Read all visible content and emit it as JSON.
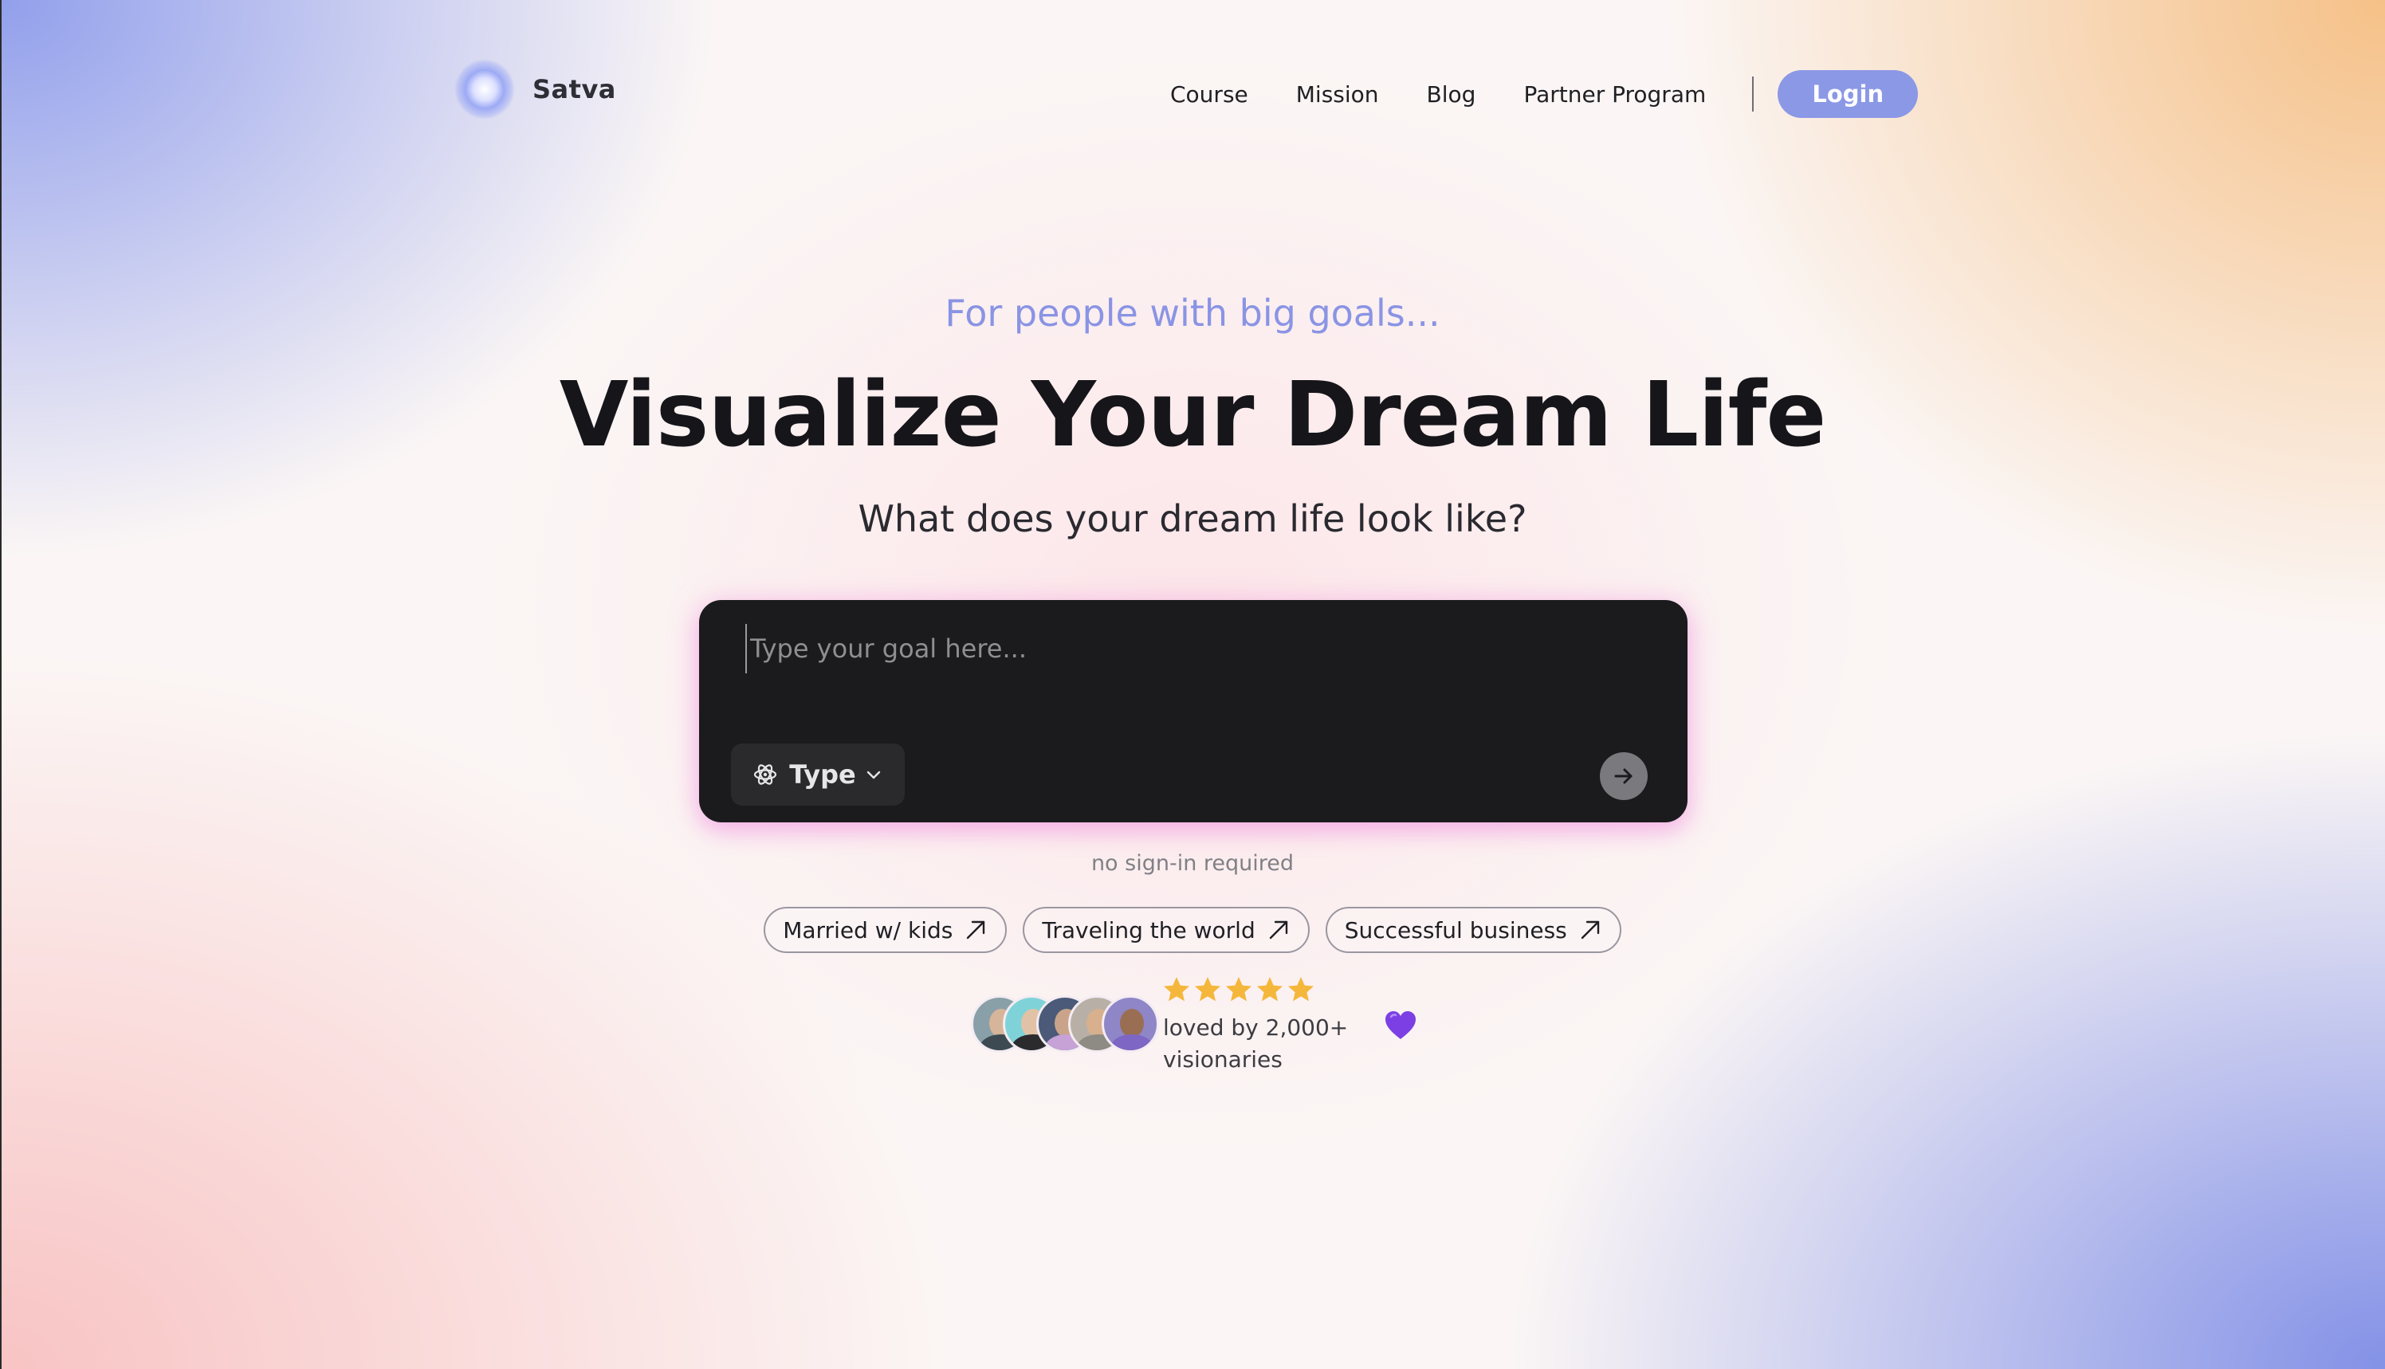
{
  "brand": {
    "name": "Satva"
  },
  "nav": {
    "links": [
      "Course",
      "Mission",
      "Blog",
      "Partner Program"
    ],
    "login_label": "Login"
  },
  "hero": {
    "eyebrow": "For people with big goals...",
    "headline": "Visualize Your Dream Life",
    "subhead": "What does your dream life look like?"
  },
  "prompt": {
    "placeholder": "Type your goal here...",
    "type_label": "Type",
    "type_icon": "atom-icon",
    "send_icon": "arrow-right-icon"
  },
  "note": "no sign-in required",
  "chips": [
    {
      "label": "Married w/ kids"
    },
    {
      "label": "Traveling the world"
    },
    {
      "label": "Successful business"
    }
  ],
  "social_proof": {
    "rating": 5,
    "rating_max": 5,
    "text": "loved by 2,000+ visionaries",
    "heart_icon": "purple-heart-icon"
  },
  "colors": {
    "accent": "#8b98e6",
    "eyebrow": "#8a94e4",
    "prompt_bg": "#1b1b1d",
    "star": "#f5b73b",
    "heart": "#7b3fe4"
  }
}
